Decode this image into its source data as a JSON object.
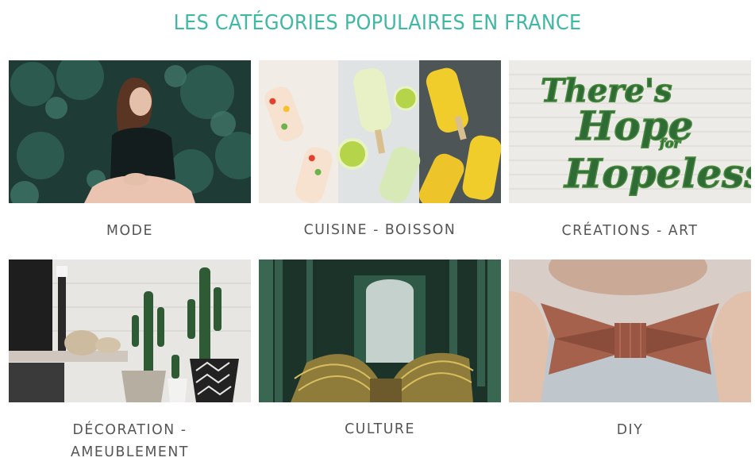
{
  "section": {
    "title": "LES CATÉGORIES POPULAIRES EN FRANCE"
  },
  "categories": [
    {
      "label": "MODE",
      "image": "woman-in-foliage"
    },
    {
      "label": "CUISINE - BOISSON",
      "image": "popsicles"
    },
    {
      "label": "CRÉATIONS - ART",
      "image": "moss-lettering-wall"
    },
    {
      "label": "DÉCORATION -\nAMEUBLEMENT",
      "image": "cactus-decor"
    },
    {
      "label": "CULTURE",
      "image": "grand-palais-staircase"
    },
    {
      "label": "DIY",
      "image": "paper-bow-tie"
    }
  ],
  "artwork": {
    "moss_lettering": [
      "There's",
      "Hope",
      "for",
      "Hopeless"
    ]
  },
  "colors": {
    "accent": "#3fb8a4",
    "label": "#555555"
  }
}
